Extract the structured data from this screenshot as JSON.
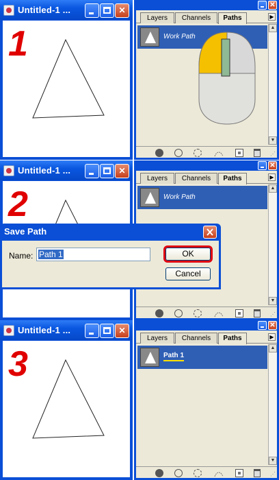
{
  "document": {
    "title": "Untitled-1 ..."
  },
  "palette": {
    "tabs": [
      "Layers",
      "Channels",
      "Paths"
    ],
    "active_tab": "Paths"
  },
  "steps": [
    {
      "number": "1",
      "path_name": "Work Path"
    },
    {
      "number": "2",
      "path_name": "Work Path"
    },
    {
      "number": "3",
      "path_name": "Path 1"
    }
  ],
  "dialog": {
    "title": "Save Path",
    "name_label": "Name:",
    "name_value": "Path 1",
    "ok_label": "OK",
    "cancel_label": "Cancel"
  },
  "colors": {
    "titlebar": "#0a4fd6",
    "selected_row": "#2f5fb5",
    "highlight": "#e00000",
    "mouse_click": "#f5c000"
  },
  "icons": [
    "minimize-icon",
    "maximize-icon",
    "close-icon",
    "fill-path-icon",
    "stroke-path-icon",
    "load-selection-icon",
    "work-path-icon",
    "new-path-icon",
    "trash-icon",
    "mouse-double-click-icon"
  ]
}
